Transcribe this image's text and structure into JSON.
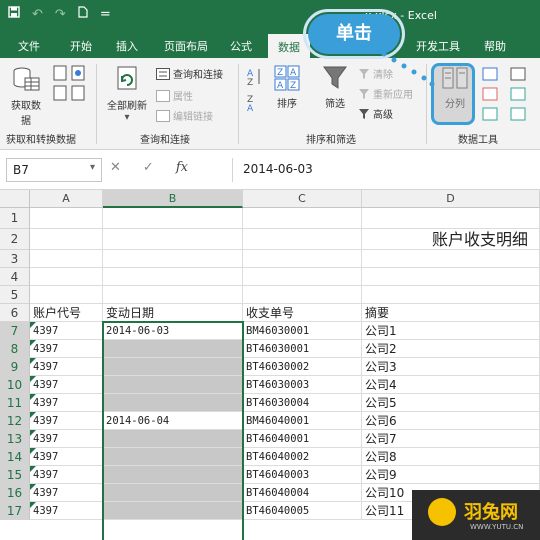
{
  "title_bar": {
    "save_icon": "save-icon",
    "undo_icon": "undo-icon",
    "redo_icon": "redo-icon",
    "new_icon": "new-file-icon",
    "customize": "=",
    "title": "x.xlsx - Excel"
  },
  "tabs": [
    "文件",
    "开始",
    "插入",
    "页面布局",
    "公式",
    "数据",
    "开发工具",
    "帮助"
  ],
  "active_tab": "数据",
  "callout": "单击",
  "ribbon": {
    "get_data": {
      "label_1": "获取数",
      "label_2": "据",
      "group": "获取和转换数据"
    },
    "refresh_all": {
      "label": "全部刷新",
      "group": "查询和连接"
    },
    "queries": "查询和连接",
    "properties": "属性",
    "edit_links": "编辑链接",
    "sort_az": "A↓Z",
    "sort": "排序",
    "filter": "筛选",
    "clear": "清除",
    "reapply": "重新应用",
    "advanced": "高级",
    "sort_group": "排序和筛选",
    "split": "分列",
    "tools_group": "数据工具"
  },
  "formula_bar": {
    "name_box": "B7",
    "cancel": "✕",
    "enter": "✓",
    "fx": "fx",
    "content": "2014-06-03"
  },
  "columns": [
    "A",
    "B",
    "C",
    "D"
  ],
  "rows": [
    "1",
    "2",
    "3",
    "4",
    "5",
    "6",
    "7",
    "8",
    "9",
    "10",
    "11",
    "12",
    "13",
    "14",
    "15",
    "16",
    "17"
  ],
  "sheet": {
    "title_d2": "账户收支明细",
    "headers": {
      "a": "账户代号",
      "b": "变动日期",
      "c": "收支单号",
      "d": "摘要"
    },
    "data": [
      {
        "a": "4397",
        "b": "2014-06-03",
        "c": "BM46030001",
        "d": "公司1"
      },
      {
        "a": "4397",
        "b": "",
        "c": "BT46030001",
        "d": "公司2"
      },
      {
        "a": "4397",
        "b": "",
        "c": "BT46030002",
        "d": "公司3"
      },
      {
        "a": "4397",
        "b": "",
        "c": "BT46030003",
        "d": "公司4"
      },
      {
        "a": "4397",
        "b": "",
        "c": "BT46030004",
        "d": "公司5"
      },
      {
        "a": "4397",
        "b": "2014-06-04",
        "c": "BM46040001",
        "d": "公司6"
      },
      {
        "a": "4397",
        "b": "",
        "c": "BT46040001",
        "d": "公司7"
      },
      {
        "a": "4397",
        "b": "",
        "c": "BT46040002",
        "d": "公司8"
      },
      {
        "a": "4397",
        "b": "",
        "c": "BT46040003",
        "d": "公司9"
      },
      {
        "a": "4397",
        "b": "",
        "c": "BT46040004",
        "d": "公司10"
      },
      {
        "a": "4397",
        "b": "",
        "c": "BT46040005",
        "d": "公司11"
      }
    ]
  },
  "watermark": {
    "brand": "羽兔网",
    "url": "WWW.YUTU.CN"
  },
  "colors": {
    "excel_green": "#217346",
    "callout_blue": "#3a9fd8",
    "selection_gray": "#c8c8c8"
  }
}
